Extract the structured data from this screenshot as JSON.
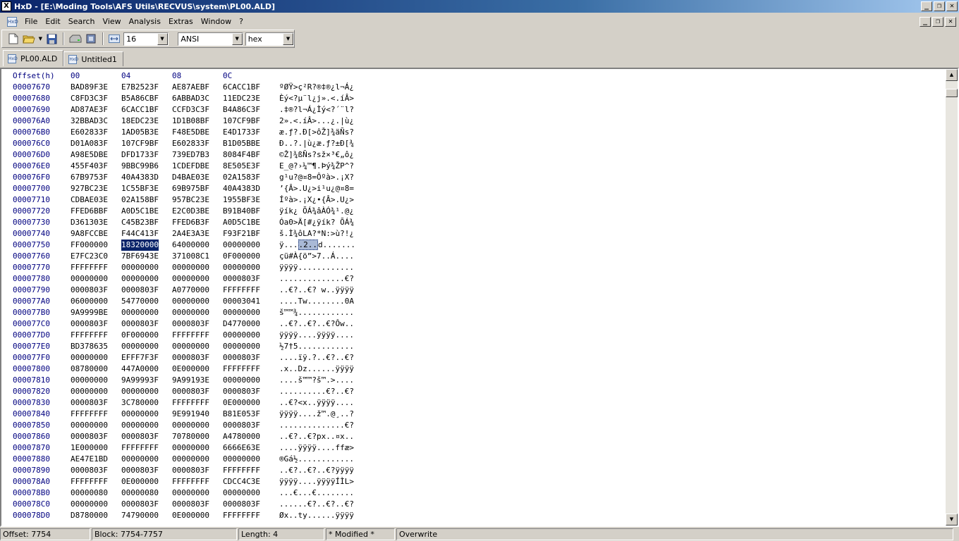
{
  "window": {
    "app_icon": "X",
    "title": "HxD - [E:\\Moding Tools\\AFS Utils\\RECVUS\\system\\PL00.ALD]",
    "minimize": "_",
    "restore": "❐",
    "close": "✕"
  },
  "menu": {
    "icon": "hex-document-icon",
    "items": [
      "File",
      "Edit",
      "Search",
      "View",
      "Analysis",
      "Extras",
      "Window",
      "?"
    ]
  },
  "toolbar": {
    "bytes_per_row": "16",
    "charset": "ANSI",
    "offset_base": "hex"
  },
  "tabs": [
    {
      "label": "PL00.ALD",
      "active": true
    },
    {
      "label": "Untitled1",
      "active": false
    }
  ],
  "hex": {
    "header_label": "Offset(h)",
    "column_headers": [
      "00",
      "04",
      "08",
      "0C"
    ],
    "rows": [
      {
        "offset": "00007670",
        "groups": [
          "BAD89F3E",
          "E7B2523F",
          "AE87AEBF",
          "6CACC1BF"
        ],
        "ascii": "ºØŸ>ç²R?®‡®¿l¬Á¿"
      },
      {
        "offset": "00007680",
        "groups": [
          "C8FD3C3F",
          "B5A86CBF",
          "6ABBAD3C",
          "11EDC23E"
        ],
        "ascii": "Èý<?µ¨l¿j».<.íÂ>"
      },
      {
        "offset": "00007690",
        "groups": [
          "AD87AE3F",
          "6CACC1BF",
          "CCFD3C3F",
          "B4A86C3F"
        ],
        "ascii": ".‡®?l¬Á¿Ìý<?´¨l?"
      },
      {
        "offset": "000076A0",
        "groups": [
          "32BBAD3C",
          "18EDC23E",
          "1D1B08BF",
          "107CF9BF"
        ],
        "ascii": "2».<.íÂ>...¿.|ù¿"
      },
      {
        "offset": "000076B0",
        "groups": [
          "E602833F",
          "1AD05B3E",
          "F48E5DBE",
          "E4D1733F"
        ],
        "ascii": "æ.ƒ?.Ð[>ôŽ]¾äÑs?"
      },
      {
        "offset": "000076C0",
        "groups": [
          "D01A083F",
          "107CF9BF",
          "E602833F",
          "B1D05BBE"
        ],
        "ascii": "Ð..?.|ù¿æ.ƒ?±Ð[¾"
      },
      {
        "offset": "000076D0",
        "groups": [
          "A98E5DBE",
          "DFD1733F",
          "739ED7B3",
          "8084F4BF"
        ],
        "ascii": "©Ž]¾ßÑs?sž×³€„ô¿"
      },
      {
        "offset": "000076E0",
        "groups": [
          "455F403F",
          "9BBC99B6",
          "1CDEFDBE",
          "8E505E3F"
        ],
        "ascii": "E_@?›¼™¶.Þý¾ŽP^?"
      },
      {
        "offset": "000076F0",
        "groups": [
          "67B9753F",
          "40A4383D",
          "D4BAE03E",
          "02A1583F"
        ],
        "ascii": "g¹u?@¤8=Ôºà>.¡X?"
      },
      {
        "offset": "00007700",
        "groups": [
          "927BC23E",
          "1C55BF3E",
          "69B975BF",
          "40A4383D"
        ],
        "ascii": "’{Â>.U¿>i¹u¿@¤8="
      },
      {
        "offset": "00007710",
        "groups": [
          "CDBAE03E",
          "02A158BF",
          "957BC23E",
          "1955BF3E"
        ],
        "ascii": "Íºà>.¡X¿•{Â>.U¿>"
      },
      {
        "offset": "00007720",
        "groups": [
          "FFED6BBF",
          "A0D5C1BE",
          "E2C0D3BE",
          "B91B40BF"
        ],
        "ascii": "ÿík¿ ÕÁ¾âÀÓ¾¹.@¿"
      },
      {
        "offset": "00007730",
        "groups": [
          "D361303E",
          "C45B23BF",
          "FFED6B3F",
          "A0D5C1BE"
        ],
        "ascii": "Óa0>Ä[#¿ÿík? ÕÁ¾"
      },
      {
        "offset": "00007740",
        "groups": [
          "9A8FCCBE",
          "F44C413F",
          "2A4E3A3E",
          "F93F21BF"
        ],
        "ascii": "š.Ì¾ôLA?*N:>ù?!¿"
      },
      {
        "offset": "00007750",
        "groups": [
          "FF000000",
          "18320000",
          "64000000",
          "00000000"
        ],
        "ascii": "ÿ....2..d.......",
        "sel_group": 1
      },
      {
        "offset": "00007760",
        "groups": [
          "E7FC23C0",
          "7BF6943E",
          "371008C1",
          "0F000000"
        ],
        "ascii": "çü#À{ö”>7..Á...."
      },
      {
        "offset": "00007770",
        "groups": [
          "FFFFFFFF",
          "00000000",
          "00000000",
          "00000000"
        ],
        "ascii": "ÿÿÿÿ............"
      },
      {
        "offset": "00007780",
        "groups": [
          "00000000",
          "00000000",
          "00000000",
          "0000803F"
        ],
        "ascii": "..............€?"
      },
      {
        "offset": "00007790",
        "groups": [
          "0000803F",
          "0000803F",
          "A0770000",
          "FFFFFFFF"
        ],
        "ascii": "..€?..€? w..ÿÿÿÿ"
      },
      {
        "offset": "000077A0",
        "groups": [
          "06000000",
          "54770000",
          "00000000",
          "00003041"
        ],
        "ascii": "....Tw........0A"
      },
      {
        "offset": "000077B0",
        "groups": [
          "9A9999BE",
          "00000000",
          "00000000",
          "00000000"
        ],
        "ascii": "š™™¾............"
      },
      {
        "offset": "000077C0",
        "groups": [
          "0000803F",
          "0000803F",
          "0000803F",
          "D4770000"
        ],
        "ascii": "..€?..€?..€?Ôw.."
      },
      {
        "offset": "000077D0",
        "groups": [
          "FFFFFFFF",
          "0F000000",
          "FFFFFFFF",
          "00000000"
        ],
        "ascii": "ÿÿÿÿ....ÿÿÿÿ...."
      },
      {
        "offset": "000077E0",
        "groups": [
          "BD378635",
          "00000000",
          "00000000",
          "00000000"
        ],
        "ascii": "½7†5............"
      },
      {
        "offset": "000077F0",
        "groups": [
          "00000000",
          "EFFF7F3F",
          "0000803F",
          "0000803F"
        ],
        "ascii": "....ïÿ.?..€?..€?"
      },
      {
        "offset": "00007800",
        "groups": [
          "08780000",
          "447A0000",
          "0E000000",
          "FFFFFFFF"
        ],
        "ascii": ".x..Dz......ÿÿÿÿ"
      },
      {
        "offset": "00007810",
        "groups": [
          "00000000",
          "9A99993F",
          "9A99193E",
          "00000000"
        ],
        "ascii": "....š™™?š™.>...."
      },
      {
        "offset": "00007820",
        "groups": [
          "00000000",
          "00000000",
          "0000803F",
          "0000803F"
        ],
        "ascii": "..........€?..€?"
      },
      {
        "offset": "00007830",
        "groups": [
          "0000803F",
          "3C780000",
          "FFFFFFFF",
          "0E000000"
        ],
        "ascii": "..€?<x..ÿÿÿÿ...."
      },
      {
        "offset": "00007840",
        "groups": [
          "FFFFFFFF",
          "00000000",
          "9E991940",
          "B81E053F"
        ],
        "ascii": "ÿÿÿÿ....ž™.@¸..?"
      },
      {
        "offset": "00007850",
        "groups": [
          "00000000",
          "00000000",
          "00000000",
          "0000803F"
        ],
        "ascii": "..............€?"
      },
      {
        "offset": "00007860",
        "groups": [
          "0000803F",
          "0000803F",
          "70780000",
          "A4780000"
        ],
        "ascii": "..€?..€?px..¤x.."
      },
      {
        "offset": "00007870",
        "groups": [
          "1E000000",
          "FFFFFFFF",
          "00000000",
          "6666E63E"
        ],
        "ascii": "....ÿÿÿÿ....ffæ>"
      },
      {
        "offset": "00007880",
        "groups": [
          "AE47E1BD",
          "00000000",
          "00000000",
          "00000000"
        ],
        "ascii": "®Gá½............"
      },
      {
        "offset": "00007890",
        "groups": [
          "0000803F",
          "0000803F",
          "0000803F",
          "FFFFFFFF"
        ],
        "ascii": "..€?..€?..€?ÿÿÿÿ"
      },
      {
        "offset": "000078A0",
        "groups": [
          "FFFFFFFF",
          "0E000000",
          "FFFFFFFF",
          "CDCC4C3E"
        ],
        "ascii": "ÿÿÿÿ....ÿÿÿÿÍÌL>"
      },
      {
        "offset": "000078B0",
        "groups": [
          "00000080",
          "00000080",
          "00000000",
          "00000000"
        ],
        "ascii": "...€...€........"
      },
      {
        "offset": "000078C0",
        "groups": [
          "00000000",
          "0000803F",
          "0000803F",
          "0000803F"
        ],
        "ascii": "......€?..€?..€?"
      },
      {
        "offset": "000078D0",
        "groups": [
          "D8780000",
          "74790000",
          "0E000000",
          "FFFFFFFF"
        ],
        "ascii": "Øx..ty......ÿÿÿÿ"
      }
    ]
  },
  "status": {
    "offset": "Offset: 7754",
    "block": "Block: 7754-7757",
    "length": "Length: 4",
    "modified": "* Modified *",
    "mode": "Overwrite"
  }
}
